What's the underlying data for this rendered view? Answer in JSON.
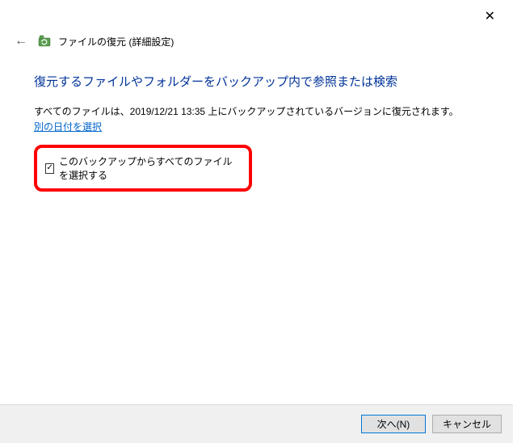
{
  "window": {
    "title": "ファイルの復元 (詳細設定)"
  },
  "content": {
    "heading": "復元するファイルやフォルダーをバックアップ内で参照または検索",
    "description": "すべてのファイルは、2019/12/21 13:35 上にバックアップされているバージョンに復元されます。",
    "date_link": "別の日付を選択",
    "checkbox_label": "このバックアップからすべてのファイルを選択する",
    "checkbox_checked": true
  },
  "footer": {
    "next_label": "次へ(N)",
    "cancel_label": "キャンセル"
  }
}
